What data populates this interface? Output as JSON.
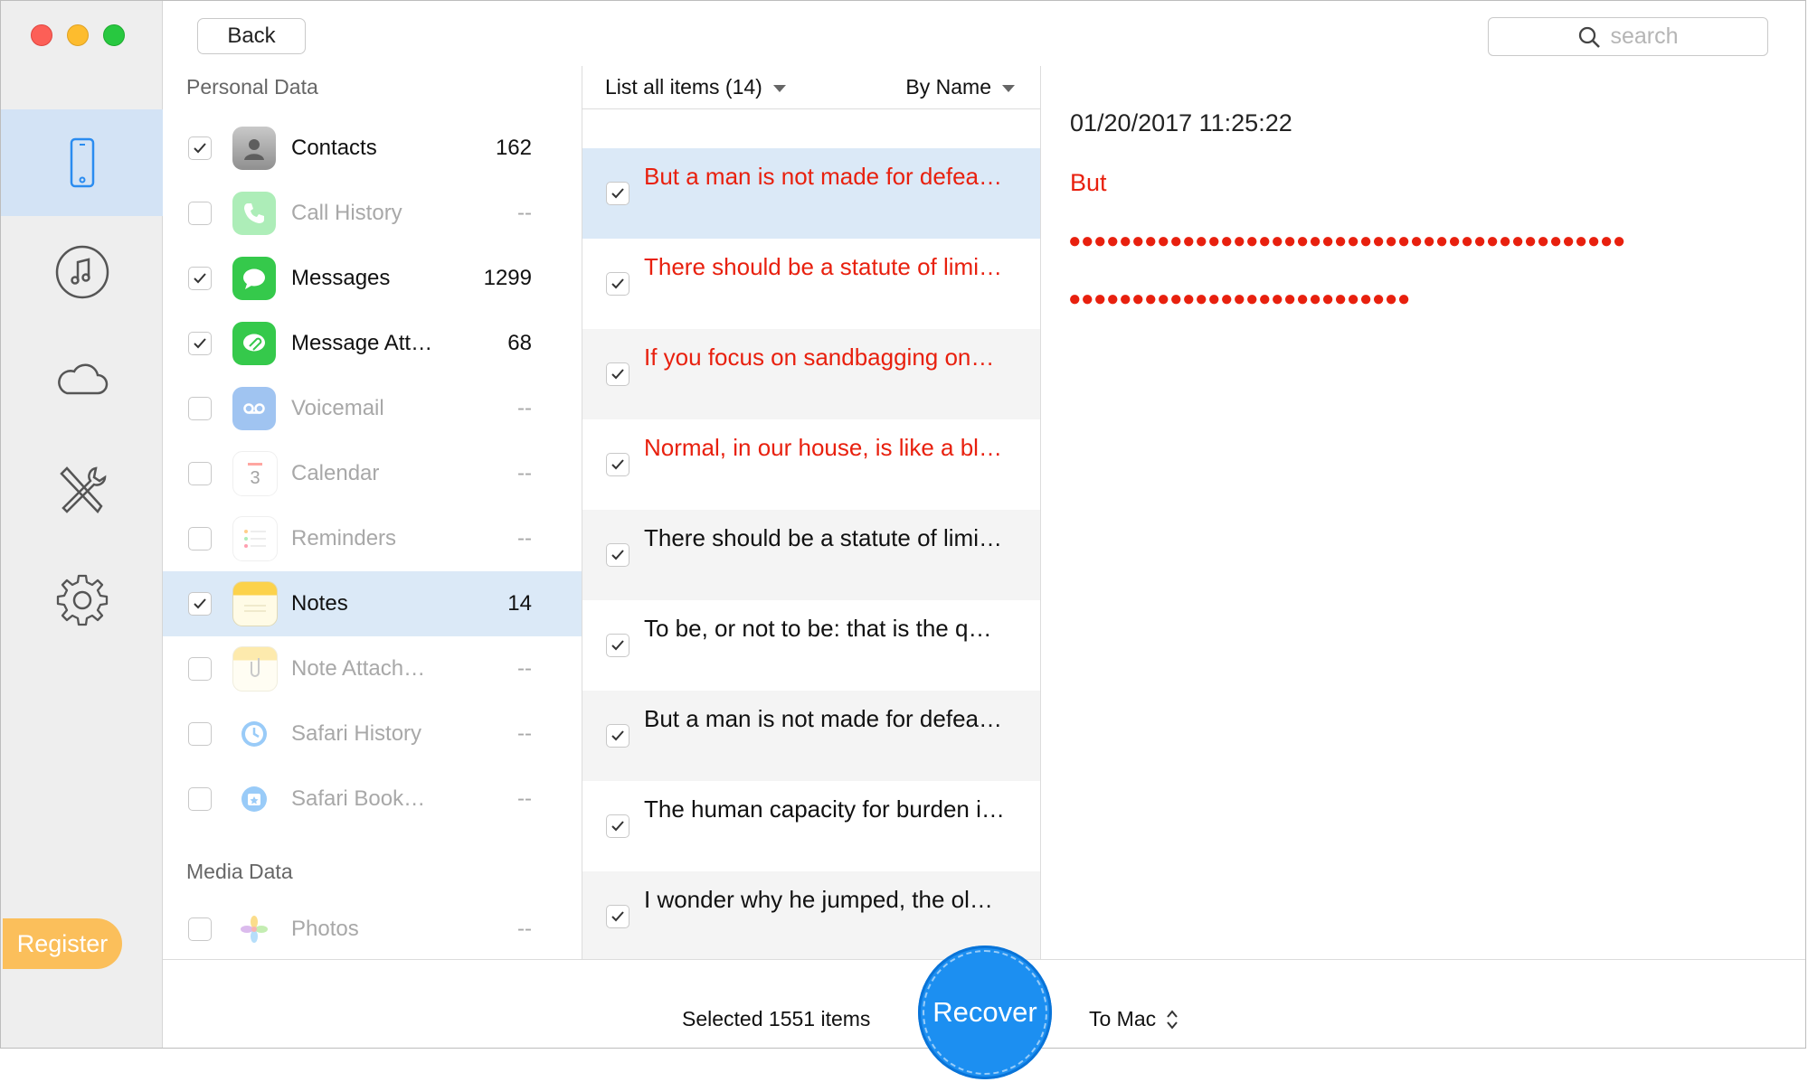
{
  "window": {
    "colors": {
      "close": "#fc5f57",
      "minimize": "#fdbc2e",
      "zoom": "#28c840",
      "accent": "#1c8ff1",
      "highlight_red": "#e8200e"
    }
  },
  "rail": {
    "items": [
      {
        "icon": "phone-icon",
        "active": true
      },
      {
        "icon": "music-icon",
        "active": false
      },
      {
        "icon": "cloud-icon",
        "active": false
      },
      {
        "icon": "tools-icon",
        "active": false
      },
      {
        "icon": "gear-icon",
        "active": false
      }
    ],
    "register_label": "Register"
  },
  "toolbar": {
    "back_label": "Back",
    "search_placeholder": "search"
  },
  "categories": {
    "personal_title": "Personal Data",
    "media_title": "Media Data",
    "items": [
      {
        "label": "Contacts",
        "count": "162",
        "checked": true,
        "enabled": true,
        "icon": "contacts-icon"
      },
      {
        "label": "Call History",
        "count": "--",
        "checked": false,
        "enabled": false,
        "icon": "phone-call-icon"
      },
      {
        "label": "Messages",
        "count": "1299",
        "checked": true,
        "enabled": true,
        "icon": "messages-icon"
      },
      {
        "label": "Message Att…",
        "count": "68",
        "checked": true,
        "enabled": true,
        "icon": "message-attachment-icon"
      },
      {
        "label": "Voicemail",
        "count": "--",
        "checked": false,
        "enabled": false,
        "icon": "voicemail-icon"
      },
      {
        "label": "Calendar",
        "count": "--",
        "checked": false,
        "enabled": false,
        "icon": "calendar-icon"
      },
      {
        "label": "Reminders",
        "count": "--",
        "checked": false,
        "enabled": false,
        "icon": "reminders-icon"
      },
      {
        "label": "Notes",
        "count": "14",
        "checked": true,
        "enabled": true,
        "icon": "notes-icon"
      },
      {
        "label": "Note Attach…",
        "count": "--",
        "checked": false,
        "enabled": false,
        "icon": "note-attachment-icon"
      },
      {
        "label": "Safari History",
        "count": "--",
        "checked": false,
        "enabled": false,
        "icon": "safari-history-icon"
      },
      {
        "label": "Safari Book…",
        "count": "--",
        "checked": false,
        "enabled": false,
        "icon": "safari-bookmark-icon"
      }
    ],
    "media_items": [
      {
        "label": "Photos",
        "count": "--",
        "checked": false,
        "enabled": false,
        "icon": "photos-icon"
      }
    ]
  },
  "list": {
    "filter_label": "List all items (14)",
    "sort_label": "By Name",
    "items": [
      {
        "text": "But a man is not made for defea…",
        "red": true,
        "checked": true
      },
      {
        "text": "There should be a statute of limi…",
        "red": true,
        "checked": true
      },
      {
        "text": "If you focus on sandbagging on…",
        "red": true,
        "checked": true
      },
      {
        "text": "Normal, in our house, is like a bl…",
        "red": true,
        "checked": true
      },
      {
        "text": "There should be a statute of limi…",
        "red": false,
        "checked": true
      },
      {
        "text": "To be, or not to be: that is the q…",
        "red": false,
        "checked": true
      },
      {
        "text": "But a man is not made for defea…",
        "red": false,
        "checked": true
      },
      {
        "text": "The human capacity for burden i…",
        "red": false,
        "checked": true
      },
      {
        "text": "I wonder why he jumped, the ol…",
        "red": false,
        "checked": true
      }
    ]
  },
  "detail": {
    "date": "01/20/2017 11:25:22",
    "title": "But",
    "line1": "●●●●●●●●●●●●●●●●●●●●●●●●●●●●●●●●●●●●●●●●●●●●",
    "line2": "●●●●●●●●●●●●●●●●●●●●●●●●●●●"
  },
  "footer": {
    "selected_text": "Selected 1551 items",
    "recover_label": "Recover",
    "destination": "To Mac"
  }
}
